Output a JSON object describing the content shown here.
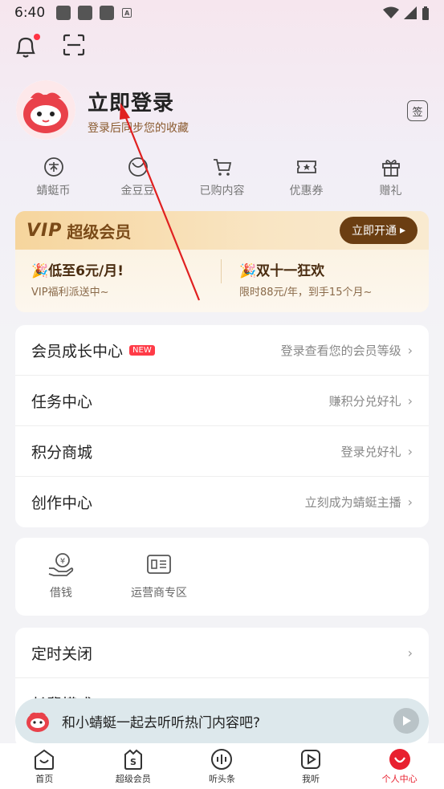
{
  "status_bar": {
    "time": "6:40",
    "a_icon": "A"
  },
  "profile": {
    "login_title": "立即登录",
    "login_subtitle": "登录后同步您的收藏",
    "sign_label": "签"
  },
  "quick_links": [
    {
      "label": "蜻蜓币",
      "icon": "coin-icon"
    },
    {
      "label": "金豆豆",
      "icon": "bean-icon"
    },
    {
      "label": "已购内容",
      "icon": "cart-icon"
    },
    {
      "label": "优惠券",
      "icon": "ticket-icon"
    },
    {
      "label": "赠礼",
      "icon": "gift-icon"
    }
  ],
  "vip": {
    "logo": "VIP",
    "title": "超级会员",
    "button": "立即开通",
    "offers": [
      {
        "main": "🎉低至6元/月!",
        "sub": "VIP福利派送中~"
      },
      {
        "main": "🎉双十一狂欢",
        "sub": "限时88元/年，到手15个月~"
      }
    ]
  },
  "menu": [
    {
      "title": "会员成长中心",
      "badge": "NEW",
      "right": "登录查看您的会员等级"
    },
    {
      "title": "任务中心",
      "right": "赚积分兑好礼"
    },
    {
      "title": "积分商城",
      "right": "登录兑好礼"
    },
    {
      "title": "创作中心",
      "right": "立刻成为蜻蜓主播"
    }
  ],
  "tools": [
    {
      "label": "借钱",
      "icon": "loan-icon"
    },
    {
      "label": "运营商专区",
      "icon": "carrier-icon"
    }
  ],
  "settings": {
    "timer_title": "定时关闭",
    "partial_title": "长辈模式"
  },
  "float_bar": {
    "text": "和小蜻蜓一起去听听热门内容吧?"
  },
  "tabs": [
    {
      "label": "首页"
    },
    {
      "label": "超级会员"
    },
    {
      "label": "听头条"
    },
    {
      "label": "我听"
    },
    {
      "label": "个人中心"
    }
  ],
  "colors": {
    "accent": "#e8202f",
    "vip_brown": "#6b3e12",
    "annotation_arrow": "#e02020"
  }
}
